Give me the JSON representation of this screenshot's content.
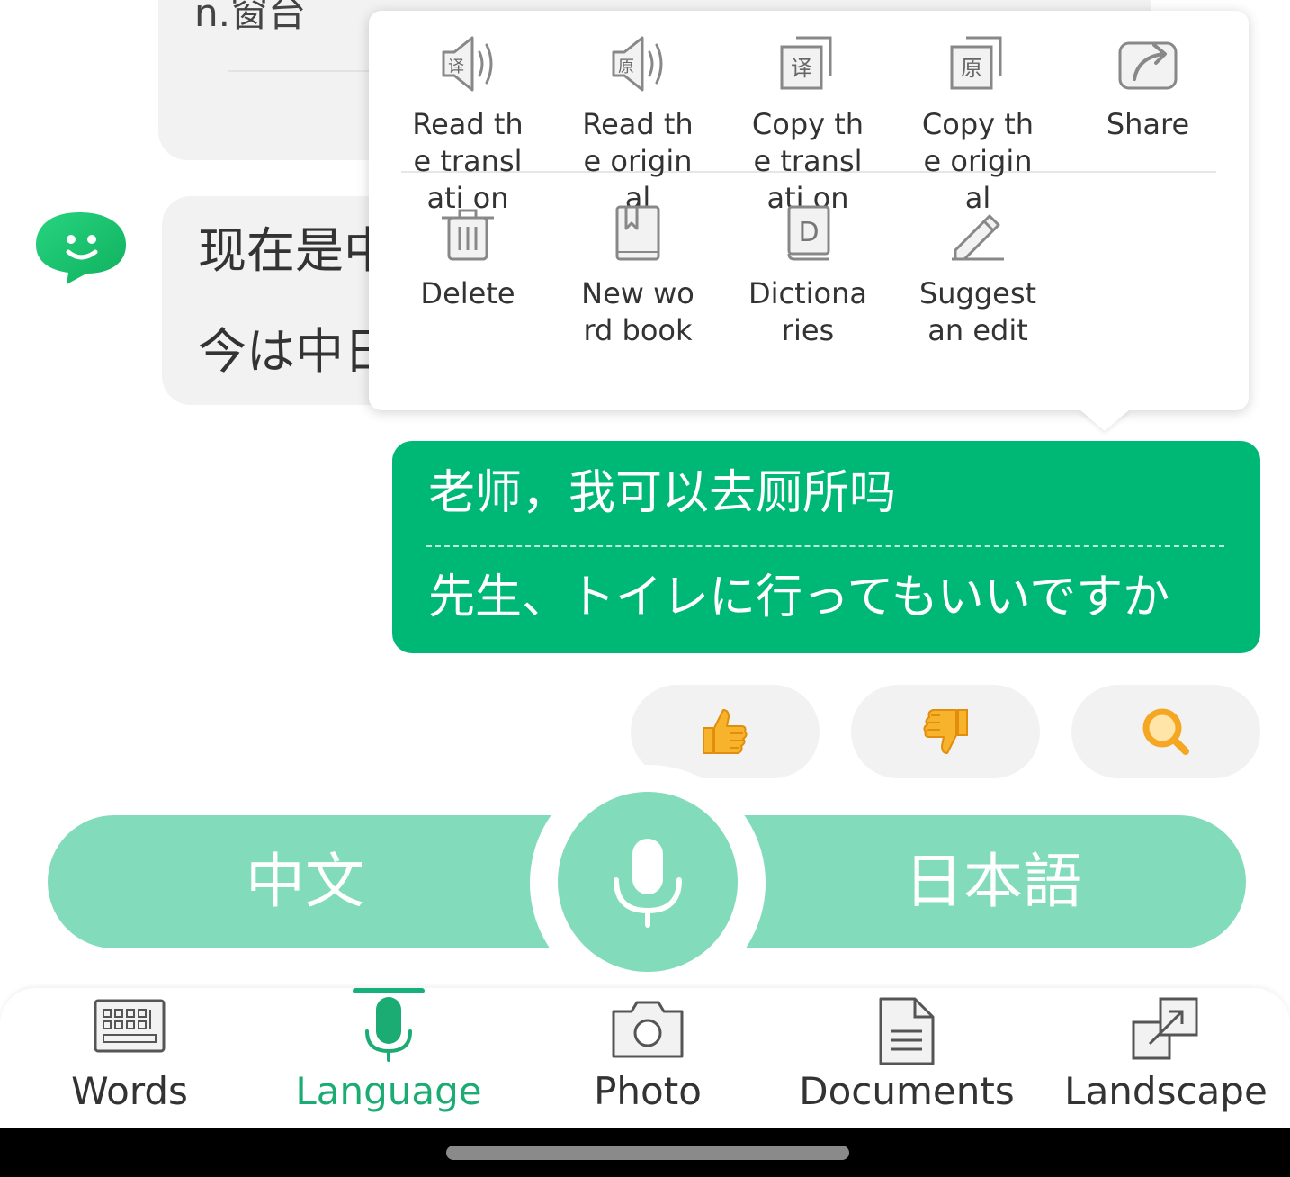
{
  "chat": {
    "top_bubble": {
      "partial_text": "n.窗台"
    },
    "gray_bubble": {
      "line1": "现在是中",
      "line2": "今は中日"
    },
    "green_bubble": {
      "source": "老师，我可以去厕所吗",
      "target": "先生、トイレに行ってもいいですか"
    }
  },
  "context_menu": {
    "row1": [
      {
        "label": "Read the translati on",
        "icon": "speaker-translation-icon"
      },
      {
        "label": "Read the original",
        "icon": "speaker-original-icon"
      },
      {
        "label": "Copy the translati on",
        "icon": "copy-translation-icon"
      },
      {
        "label": "Copy the original",
        "icon": "copy-original-icon"
      },
      {
        "label": "Share",
        "icon": "share-icon"
      }
    ],
    "row2": [
      {
        "label": "Delete",
        "icon": "trash-icon"
      },
      {
        "label": "New word book",
        "icon": "bookmark-book-icon"
      },
      {
        "label": "Dictiona ries",
        "icon": "dictionary-icon"
      },
      {
        "label": "Suggest an edit",
        "icon": "pencil-icon"
      }
    ],
    "icon_glyphs": {
      "translation": "译",
      "original": "原",
      "dictionary": "D"
    }
  },
  "feedback": {
    "icons": [
      "thumbs-up-icon",
      "thumbs-down-icon",
      "search-icon"
    ],
    "accent_color": "#f5a623"
  },
  "language_bar": {
    "source_lang": "中文",
    "target_lang": "日本語",
    "color": "#82dcbc"
  },
  "bottom_nav": {
    "items": [
      {
        "label": "Words",
        "icon": "keyboard-icon"
      },
      {
        "label": "Language",
        "icon": "microphone-icon",
        "active": true
      },
      {
        "label": "Photo",
        "icon": "camera-icon"
      },
      {
        "label": "Documents",
        "icon": "document-icon"
      },
      {
        "label": "Landscape",
        "icon": "landscape-expand-icon"
      }
    ],
    "active_color": "#1aac73"
  },
  "colors": {
    "brand_green": "#00b876",
    "bubble_gray": "#f2f2f2"
  }
}
